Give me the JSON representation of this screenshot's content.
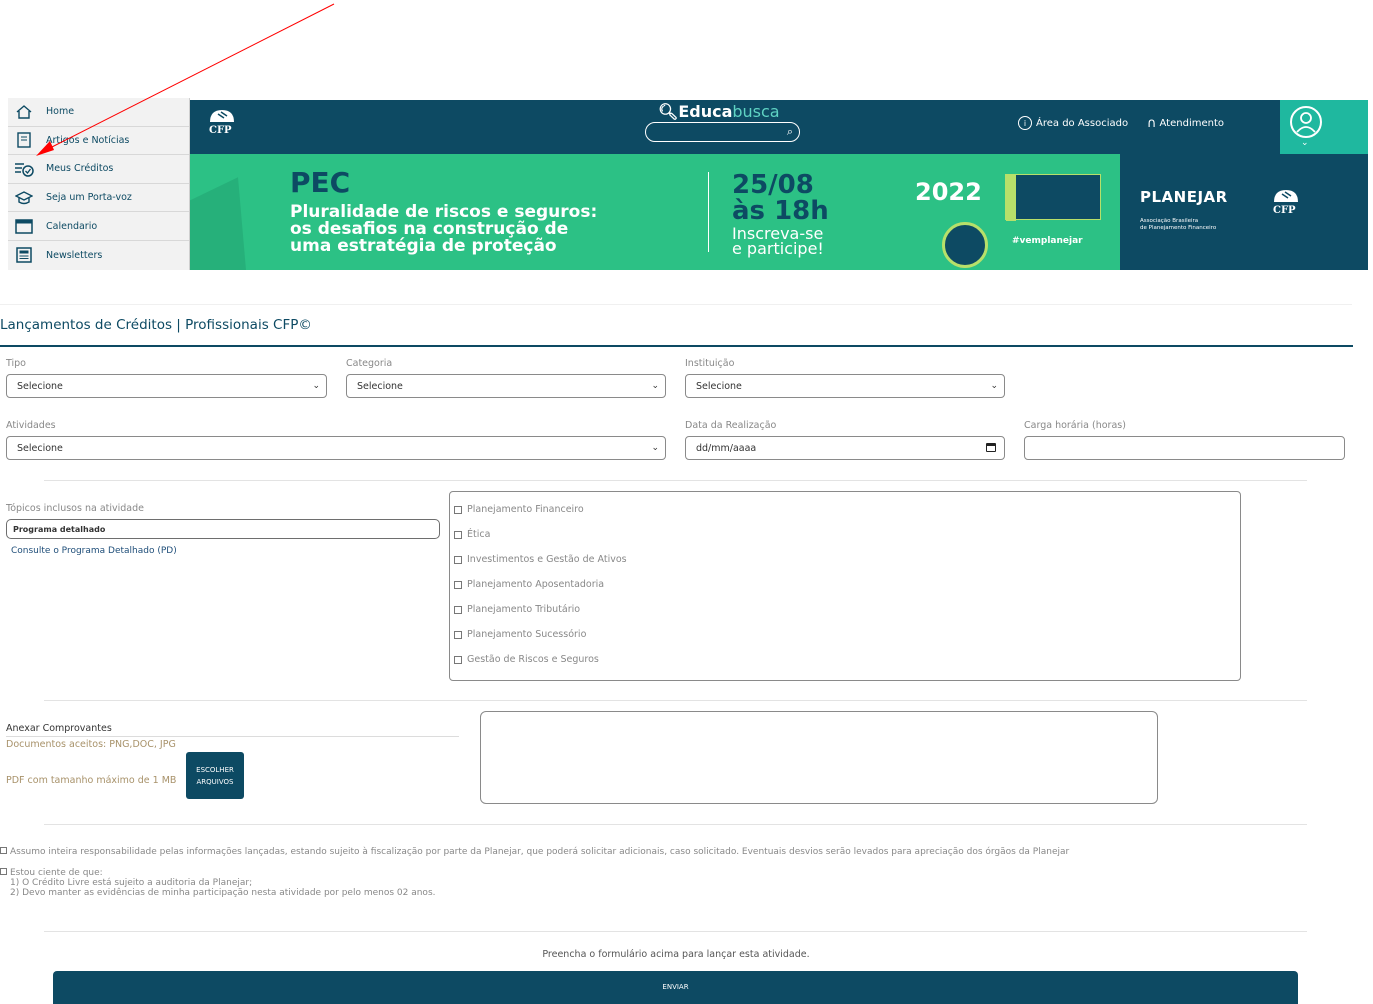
{
  "sidebar": {
    "items": [
      {
        "label": "Home",
        "icon": "home-icon"
      },
      {
        "label": "Artigos e Notícias",
        "icon": "article-icon"
      },
      {
        "label": "Meus Créditos",
        "icon": "credits-icon"
      },
      {
        "label": "Seja um Porta-voz",
        "icon": "graduation-icon"
      },
      {
        "label": "Calendario",
        "icon": "calendar-icon"
      },
      {
        "label": "Newsletters",
        "icon": "newsletter-icon"
      }
    ]
  },
  "header": {
    "brand_bold": "Educa",
    "brand_light": "busca",
    "associate_link": "Área do Associado",
    "support_link": "Atendimento"
  },
  "banner": {
    "title": "PEC",
    "subtitle_lines": [
      "Pluralidade de riscos e seguros:",
      "os desafios na construção de",
      "uma estratégia de proteção"
    ],
    "date": "25/08",
    "time": "às 18h",
    "cta_lines": [
      "Inscreva-se",
      "e participe!"
    ],
    "year": "2022",
    "hashtag": "#vemplanejar",
    "org_name": "PLANEJAR",
    "org_sub_lines": [
      "Associação Brasileira",
      "de Planejamento Financeiro"
    ]
  },
  "form": {
    "title": "Lançamentos de Créditos | Profissionais CFP©",
    "tipo_label": "Tipo",
    "tipo_value": "Selecione",
    "categoria_label": "Categoria",
    "categoria_value": "Selecione",
    "instituicao_label": "Instituição",
    "instituicao_value": "Selecione",
    "atividades_label": "Atividades",
    "atividades_value": "Selecione",
    "data_label": "Data da Realização",
    "data_placeholder": "dd/mm/aaaa",
    "carga_label": "Carga horária (horas)",
    "carga_value": "",
    "topicos_label": "Tópicos inclusos na atividade",
    "programa_value": "Programa detalhado",
    "programa_link": "Consulte o Programa Detalhado (PD)",
    "topics": [
      "Planejamento Financeiro",
      "Ética",
      "Investimentos e Gestão de Ativos",
      "Planejamento Aposentadoria",
      "Planejamento Tributário",
      "Planejamento Sucessório",
      "Gestão de Riscos e Seguros"
    ],
    "anexar_label": "Anexar Comprovantes",
    "docs_aceitos": "Documentos aceitos: PNG,DOC, JPG",
    "pdf_max": "PDF com tamanho máximo de 1 MB",
    "choose_files_line1": "ESCOLHER",
    "choose_files_line2": "ARQUIVOS",
    "declaracao_1": "Assumo inteira responsabilidade pelas informações lançadas, estando sujeito à fiscalização por parte da Planejar, que poderá solicitar adicionais, caso solicitado. Eventuais desvios serão levados para apreciação dos órgãos da Planejar",
    "declaracao_2_title": "Estou ciente de que:",
    "declaracao_2_item1": "1) O Crédito Livre está sujeito a auditoria da Planejar;",
    "declaracao_2_item2": "2) Devo manter as evidências de minha participação nesta atividade por pelo menos 02 anos.",
    "fill_message": "Preencha o formulário acima para lançar esta atividade.",
    "submit_label": "ENVIAR"
  },
  "colors": {
    "primary": "#0d4a63",
    "banner_green": "#2cc185",
    "accent_teal": "#1fb89f",
    "annotation_red": "#ff0000"
  }
}
